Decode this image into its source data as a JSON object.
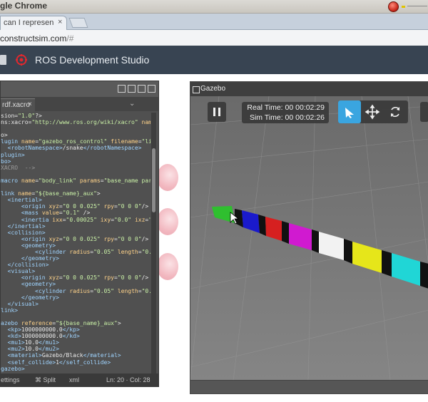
{
  "browser": {
    "window_title": "gle Chrome",
    "tab_title": "can I represen",
    "tab_close": "×",
    "url_host": "constructsim.com",
    "url_rest": "/#"
  },
  "ros": {
    "title": "ROS Development Studio"
  },
  "editor": {
    "tab_label": "rdf.xacro",
    "tab_close": "×",
    "chevron": "⌄",
    "status_settings": "ettings",
    "status_split": "⌘ Split",
    "status_lang": "xml",
    "status_pos": "Ln: 20 · Col: 28"
  },
  "gazebo": {
    "window_title": "Gazebo",
    "real_time": "Real Time: 00 00:02:29",
    "sim_time": "Sim Time: 00 00:02:26",
    "icons": [
      "pause-icon",
      "select-arrow-icon",
      "translate-icon",
      "rotate-icon"
    ],
    "snake_colors": [
      "#2fbf2f",
      "#1a1acc",
      "#d62020",
      "#d01ad0",
      "#f2f2f2",
      "#e6e61a",
      "#20d6d6"
    ],
    "accent": "#3aa5e0"
  }
}
